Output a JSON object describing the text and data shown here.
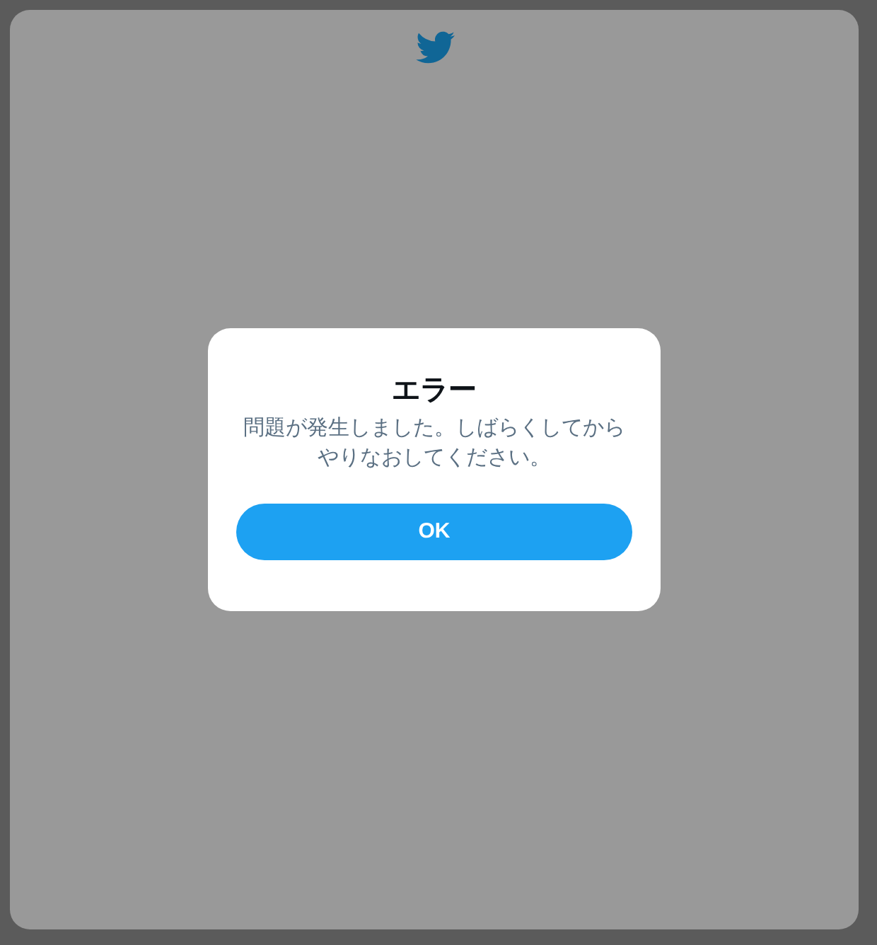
{
  "dialog": {
    "title": "エラー",
    "message": "問題が発生しました。しばらくしてからやりなおしてください。",
    "buttons": [
      "OK"
    ]
  }
}
